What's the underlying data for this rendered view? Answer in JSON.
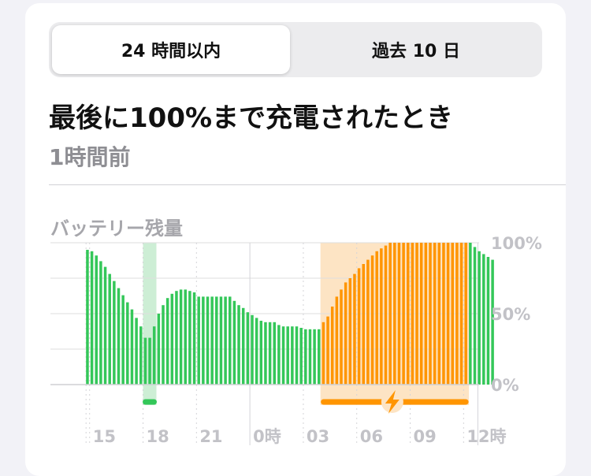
{
  "tabs": {
    "active": "24 時間以内",
    "inactive": "過去 10 日"
  },
  "title": "最後に100%まで充電されたとき",
  "subtitle": "1時間前",
  "chart_title": "バッテリー残量",
  "colors": {
    "battery": "#34c759",
    "charging": "#ff9500",
    "charging_bg": "#fde4c4",
    "low_power_bg": "#cdeed5",
    "grid": "#dedede"
  },
  "icons": {
    "charging": "lightning-bolt-icon"
  },
  "chart_data": {
    "type": "bar",
    "ylabel_ticks": [
      "100%",
      "50%",
      "0%"
    ],
    "ylim": [
      0,
      100
    ],
    "x_tick_labels": [
      "15",
      "18",
      "21",
      "0時",
      "03",
      "06",
      "09",
      "12時"
    ],
    "x_tick_hours": [
      15,
      18,
      21,
      24,
      27,
      30,
      33,
      36
    ],
    "start_hour": 14.8,
    "bar_interval_hours": 0.25,
    "charging_bars": [
      53,
      85
    ],
    "low_power_window_hours": [
      18,
      18.75
    ],
    "values": [
      95,
      94,
      91,
      87,
      83,
      78,
      73,
      68,
      63,
      58,
      53,
      47,
      41,
      33,
      33,
      41,
      50,
      56,
      61,
      64,
      66,
      67,
      67,
      66,
      65,
      62,
      62,
      62,
      62,
      62,
      62,
      62,
      62,
      59,
      56,
      54,
      51,
      49,
      47,
      45,
      44,
      44,
      44,
      42,
      41,
      41,
      41,
      41,
      40,
      39,
      39,
      39,
      39,
      44,
      48,
      55,
      62,
      67,
      72,
      75,
      78,
      82,
      85,
      88,
      91,
      94,
      96,
      98,
      100,
      100,
      100,
      100,
      100,
      100,
      100,
      100,
      100,
      100,
      100,
      100,
      100,
      100,
      100,
      100,
      100,
      100,
      100,
      97,
      94,
      92,
      90,
      88
    ]
  }
}
